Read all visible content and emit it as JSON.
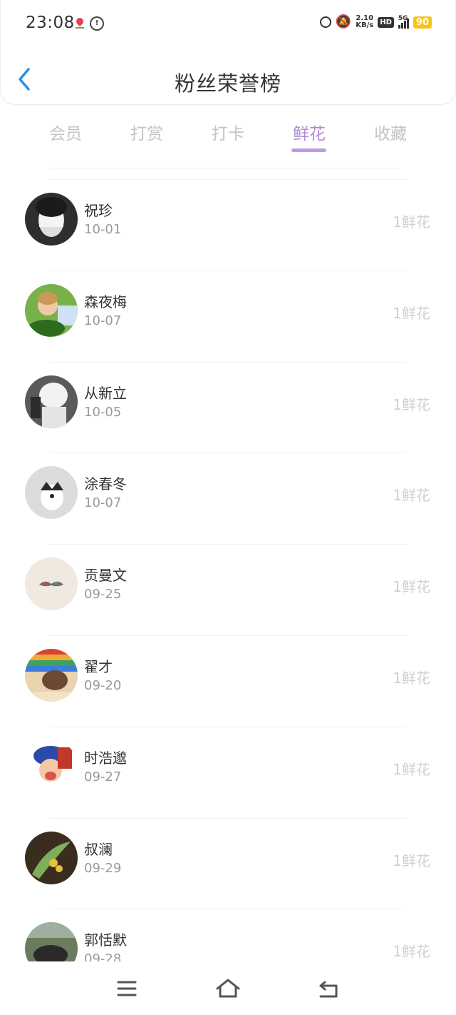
{
  "status_bar": {
    "time": "23:08",
    "network_speed_value": "2.10",
    "network_speed_unit": "KB/s",
    "hd_label": "HD",
    "signal_label": "5G",
    "battery": "90"
  },
  "header": {
    "title": "粉丝荣誉榜"
  },
  "tabs": [
    {
      "label": "会员",
      "active": false
    },
    {
      "label": "打赏",
      "active": false
    },
    {
      "label": "打卡",
      "active": false
    },
    {
      "label": "鲜花",
      "active": true
    },
    {
      "label": "收藏",
      "active": false
    }
  ],
  "fans": [
    {
      "name": "祝珍",
      "date": "10-01",
      "count": "1鲜花",
      "avatar_color": "#3a3a3a"
    },
    {
      "name": "森夜梅",
      "date": "10-07",
      "count": "1鲜花",
      "avatar_color": "#5e9a3c"
    },
    {
      "name": "从新立",
      "date": "10-05",
      "count": "1鲜花",
      "avatar_color": "#6a6a6a"
    },
    {
      "name": "涂春冬",
      "date": "10-07",
      "count": "1鲜花",
      "avatar_color": "#d9d9d9"
    },
    {
      "name": "贡曼文",
      "date": "09-25",
      "count": "1鲜花",
      "avatar_color": "#efe9df"
    },
    {
      "name": "翟才",
      "date": "09-20",
      "count": "1鲜花",
      "avatar_color": "#c4785a"
    },
    {
      "name": "时浩邈",
      "date": "09-27",
      "count": "1鲜花",
      "avatar_color": "#d9534f"
    },
    {
      "name": "叔澜",
      "date": "09-29",
      "count": "1鲜花",
      "avatar_color": "#4b3a2a"
    },
    {
      "name": "郭恬默",
      "date": "09-28",
      "count": "1鲜花",
      "avatar_color": "#3d4a38"
    }
  ],
  "icons": {
    "back": "chevron-left-icon",
    "menu": "menu-icon",
    "home": "home-icon",
    "return": "return-icon"
  },
  "colors": {
    "accent": "#b18ad8",
    "back_arrow": "#2b8ee6"
  }
}
